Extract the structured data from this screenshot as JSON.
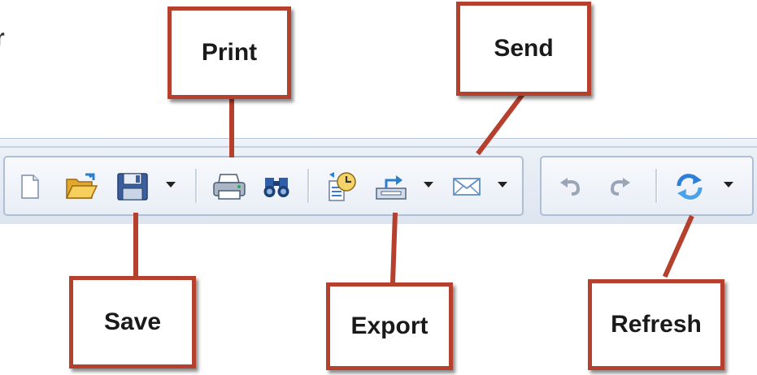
{
  "edge_text": "r",
  "callouts": {
    "print": "Print",
    "send": "Send",
    "save": "Save",
    "export": "Export",
    "refresh": "Refresh"
  },
  "toolbar": {
    "buttons": [
      {
        "name": "new-document",
        "icon": "document-icon"
      },
      {
        "name": "open",
        "icon": "folder-open-icon"
      },
      {
        "name": "save",
        "icon": "floppy-disk-icon",
        "dropdown": true
      },
      {
        "name": "print",
        "icon": "printer-icon"
      },
      {
        "name": "find",
        "icon": "binoculars-icon"
      },
      {
        "name": "schedule",
        "icon": "clock-document-icon"
      },
      {
        "name": "export",
        "icon": "export-tray-icon",
        "dropdown": true
      },
      {
        "name": "send",
        "icon": "envelope-icon",
        "dropdown": true
      },
      {
        "name": "undo",
        "icon": "undo-icon",
        "disabled": true
      },
      {
        "name": "redo",
        "icon": "redo-icon",
        "disabled": true
      },
      {
        "name": "refresh",
        "icon": "refresh-icon",
        "dropdown": true
      }
    ]
  },
  "colors": {
    "callout_border": "#b5402e",
    "toolbar_border": "#aebfd5",
    "accent_blue": "#2f6fc0"
  }
}
